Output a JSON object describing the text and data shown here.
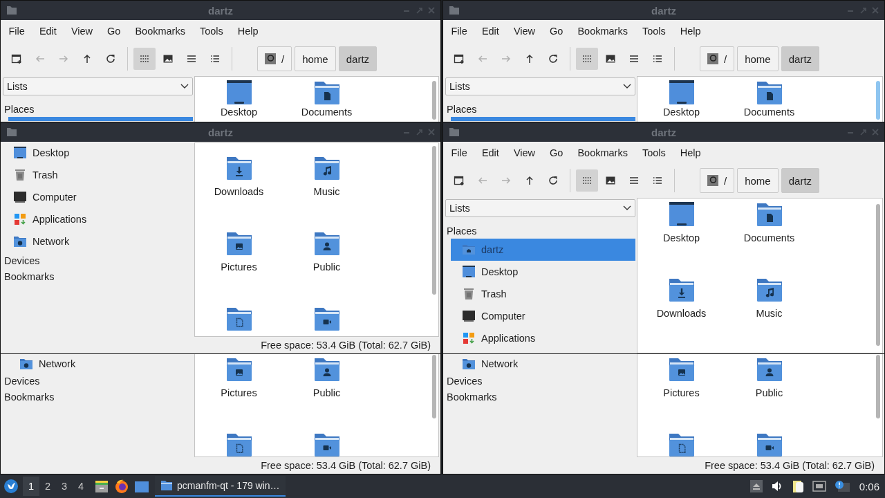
{
  "back_windows": [
    {
      "title": "dartz",
      "menu": [
        "File",
        "Edit",
        "View",
        "Go",
        "Bookmarks",
        "Tools",
        "Help"
      ],
      "toolbar": [
        {
          "kind": "new-window",
          "disabled": false,
          "selected": false
        },
        {
          "kind": "back",
          "disabled": true,
          "selected": false
        },
        {
          "kind": "forward",
          "disabled": true,
          "selected": false
        },
        {
          "kind": "up",
          "disabled": false,
          "selected": false
        },
        {
          "kind": "reload",
          "disabled": false,
          "selected": false
        },
        {
          "kind": "icon-view",
          "disabled": false,
          "selected": true
        },
        {
          "kind": "thumbnail-view",
          "disabled": false,
          "selected": false
        },
        {
          "kind": "compact-view",
          "disabled": false,
          "selected": false
        },
        {
          "kind": "detail-view",
          "disabled": false,
          "selected": false
        }
      ],
      "path": [
        {
          "kind": "root",
          "label": "/",
          "selected": false
        },
        {
          "kind": "dir",
          "label": "home",
          "selected": false
        },
        {
          "kind": "dir",
          "label": "dartz",
          "selected": true
        }
      ],
      "sidebar": {
        "dropdown": "Lists",
        "top": [
          {
            "kind": "header",
            "label": "Places"
          },
          {
            "kind": "blank",
            "selected": true
          }
        ],
        "bottom": [
          {
            "kind": "network",
            "label": "Network",
            "selected": false
          },
          {
            "kind": "header",
            "label": "Devices"
          },
          {
            "kind": "header",
            "label": "Bookmarks"
          }
        ]
      },
      "files": {
        "top": [
          {
            "kind": "desktop",
            "label": "Desktop"
          },
          {
            "kind": "documents",
            "label": "Documents"
          }
        ],
        "bottom": [
          {
            "kind": "pictures",
            "label": "Pictures"
          },
          {
            "kind": "public",
            "label": "Public"
          },
          {
            "kind": "templates"
          },
          {
            "kind": "videos"
          }
        ]
      },
      "status": "Free space: 53.4 GiB (Total: 62.7 GiB)"
    },
    {
      "title": "dartz",
      "menu": [
        "File",
        "Edit",
        "View",
        "Go",
        "Bookmarks",
        "Tools",
        "Help"
      ],
      "toolbar": [
        {
          "kind": "new-window",
          "disabled": false,
          "selected": false
        },
        {
          "kind": "back",
          "disabled": true,
          "selected": false
        },
        {
          "kind": "forward",
          "disabled": true,
          "selected": false
        },
        {
          "kind": "up",
          "disabled": false,
          "selected": false
        },
        {
          "kind": "reload",
          "disabled": false,
          "selected": false
        },
        {
          "kind": "icon-view",
          "disabled": false,
          "selected": true
        },
        {
          "kind": "thumbnail-view",
          "disabled": false,
          "selected": false
        },
        {
          "kind": "compact-view",
          "disabled": false,
          "selected": false
        },
        {
          "kind": "detail-view",
          "disabled": false,
          "selected": false
        }
      ],
      "path": [
        {
          "kind": "root",
          "label": "/",
          "selected": false
        },
        {
          "kind": "dir",
          "label": "home",
          "selected": false
        },
        {
          "kind": "dir",
          "label": "dartz",
          "selected": true
        }
      ],
      "sidebar": {
        "dropdown": "Lists",
        "top": [
          {
            "kind": "header",
            "label": "Places"
          },
          {
            "kind": "blank",
            "selected": true
          }
        ],
        "bottom": [
          {
            "kind": "network",
            "label": "Network",
            "selected": false
          },
          {
            "kind": "header",
            "label": "Devices"
          },
          {
            "kind": "header",
            "label": "Bookmarks"
          }
        ]
      },
      "files": {
        "top": [
          {
            "kind": "desktop",
            "label": "Desktop"
          },
          {
            "kind": "documents",
            "label": "Documents"
          }
        ],
        "bottom": [
          {
            "kind": "pictures",
            "label": "Pictures"
          },
          {
            "kind": "public",
            "label": "Public"
          },
          {
            "kind": "templates"
          },
          {
            "kind": "videos"
          }
        ]
      },
      "status": "Free space: 53.4 GiB (Total: 62.7 GiB)"
    }
  ],
  "front_windows": [
    {
      "title": "dartz",
      "sidebar": {
        "top": [
          {
            "kind": "desktop",
            "label": "Desktop",
            "selected": false
          },
          {
            "kind": "trash",
            "label": "Trash",
            "selected": false
          },
          {
            "kind": "computer",
            "label": "Computer",
            "selected": false
          },
          {
            "kind": "applications",
            "label": "Applications",
            "selected": false
          },
          {
            "kind": "network",
            "label": "Network",
            "selected": false
          },
          {
            "kind": "header",
            "label": "Devices"
          },
          {
            "kind": "header",
            "label": "Bookmarks"
          }
        ]
      },
      "files": {
        "top": [
          {
            "kind": "downloads",
            "label": "Downloads"
          },
          {
            "kind": "music",
            "label": "Music"
          },
          {
            "kind": "pictures",
            "label": "Pictures"
          },
          {
            "kind": "public",
            "label": "Public"
          },
          {
            "kind": "templates"
          },
          {
            "kind": "videos"
          }
        ]
      },
      "status": "Free space: 53.4 GiB (Total: 62.7 GiB)"
    },
    {
      "title": "dartz",
      "menu": [
        "File",
        "Edit",
        "View",
        "Go",
        "Bookmarks",
        "Tools",
        "Help"
      ],
      "toolbar": [
        {
          "kind": "new-window",
          "disabled": false,
          "selected": false
        },
        {
          "kind": "back",
          "disabled": true,
          "selected": false
        },
        {
          "kind": "forward",
          "disabled": true,
          "selected": false
        },
        {
          "kind": "up",
          "disabled": false,
          "selected": false
        },
        {
          "kind": "reload",
          "disabled": false,
          "selected": false
        },
        {
          "kind": "icon-view",
          "disabled": false,
          "selected": true
        },
        {
          "kind": "thumbnail-view",
          "disabled": false,
          "selected": false
        },
        {
          "kind": "compact-view",
          "disabled": false,
          "selected": false
        },
        {
          "kind": "detail-view",
          "disabled": false,
          "selected": false
        }
      ],
      "path": [
        {
          "kind": "root",
          "label": "/",
          "selected": false
        },
        {
          "kind": "dir",
          "label": "home",
          "selected": false
        },
        {
          "kind": "dir",
          "label": "dartz",
          "selected": true
        }
      ],
      "sidebar": {
        "dropdown": "Lists",
        "top": [
          {
            "kind": "header",
            "label": "Places"
          },
          {
            "kind": "home",
            "label": "dartz",
            "selected": true
          },
          {
            "kind": "desktop",
            "label": "Desktop",
            "selected": false
          },
          {
            "kind": "trash",
            "label": "Trash",
            "selected": false
          },
          {
            "kind": "computer",
            "label": "Computer",
            "selected": false
          },
          {
            "kind": "applications",
            "label": "Applications",
            "selected": false
          }
        ]
      },
      "files": {
        "top": [
          {
            "kind": "desktop",
            "label": "Desktop"
          },
          {
            "kind": "documents",
            "label": "Documents"
          },
          {
            "kind": "downloads",
            "label": "Downloads"
          },
          {
            "kind": "music",
            "label": "Music"
          }
        ]
      }
    }
  ],
  "taskbar": {
    "workspaces": [
      {
        "label": "1",
        "selected": true
      },
      {
        "label": "2",
        "selected": false
      },
      {
        "label": "3",
        "selected": false
      },
      {
        "label": "4",
        "selected": false
      }
    ],
    "tasks": [
      {
        "title": "pcmanfm-qt - 179 win…",
        "selected": true
      }
    ],
    "clock": "0:06"
  }
}
